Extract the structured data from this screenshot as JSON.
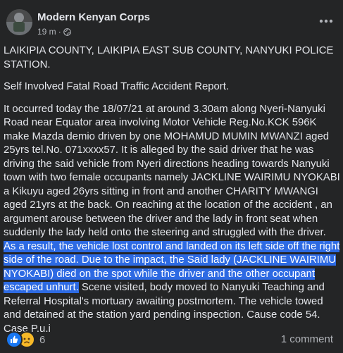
{
  "post": {
    "page_name": "Modern Kenyan Corps",
    "time": "19 m",
    "separator": "·",
    "paragraph1": "LAIKIPIA COUNTY, LAIKIPIA EAST SUB COUNTY, NANYUKI POLICE STATION.",
    "paragraph2": "Self Involved Fatal Road Traffic Accident Report.",
    "paragraph3_before": "It occurred today the 18/07/21 at around 3.30am along Nyeri-Nanyuki Road near Equator area involving Motor Vehicle Reg.No.KCK 596K make Mazda demio driven by one MOHAMUD MUMIN MWANZI aged 25yrs tel.No. 071xxxx57. It is alleged by the said driver that he was driving the said vehicle from Nyeri directions heading towards Nanyuki town with two female occupants namely JACKLINE WAIRIMU NYOKABI a Kikuyu aged 26yrs sitting in front and another  CHARITY MWANGI aged 21yrs at the back. On reaching at the location of the accident , an argument arouse between the driver and the lady in front seat when suddenly the lady held onto the steering and struggled with the driver. ",
    "paragraph3_highlight": "As a result, the vehicle lost control and landed on its left side off the right side of the road. Due to the impact, the Said lady (JACKLINE WAIRIMU NYOKABI) died on the spot while the driver and the other occupant escaped unhurt.",
    "paragraph3_after": " Scene visited, body moved to Nanyuki Teaching and Referral Hospital's mortuary awaiting postmortem. The vehicle towed and detained at the station yard pending inspection. Cause code 54. Case P.u.i",
    "reactions_count": "6",
    "comments": "1 comment"
  },
  "icons": {
    "globe": "globe-icon",
    "more": "more-options-icon",
    "like": "like-reaction-icon",
    "sad": "sad-reaction-icon"
  },
  "colors": {
    "background": "#242526",
    "text": "#e4e6eb",
    "secondary_text": "#b0b3b8",
    "highlight": "#2d6ae3",
    "like": "#1877f2",
    "sad": "#f7b928"
  }
}
